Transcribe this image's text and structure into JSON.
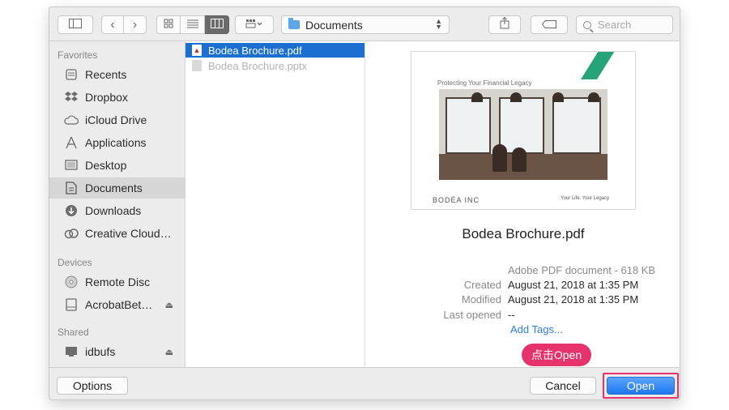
{
  "toolbar": {
    "location": "Documents",
    "search_placeholder": "Search"
  },
  "sidebar": {
    "favorites_label": "Favorites",
    "favorites": [
      {
        "label": "Recents",
        "icon": "clock-icon"
      },
      {
        "label": "Dropbox",
        "icon": "dropbox-icon"
      },
      {
        "label": "iCloud Drive",
        "icon": "cloud-icon"
      },
      {
        "label": "Applications",
        "icon": "applications-icon"
      },
      {
        "label": "Desktop",
        "icon": "desktop-icon"
      },
      {
        "label": "Documents",
        "icon": "document-icon",
        "selected": true
      },
      {
        "label": "Downloads",
        "icon": "download-icon"
      },
      {
        "label": "Creative Cloud…",
        "icon": "creative-cloud-icon"
      }
    ],
    "devices_label": "Devices",
    "devices": [
      {
        "label": "Remote Disc",
        "icon": "disc-icon"
      },
      {
        "label": "AcrobatBet…",
        "icon": "drive-icon",
        "eject": true
      }
    ],
    "shared_label": "Shared",
    "shared": [
      {
        "label": "idbufs",
        "icon": "computer-icon",
        "eject": true
      }
    ]
  },
  "files": [
    {
      "name": "Bodea Brochure.pdf",
      "selected": true
    },
    {
      "name": "Bodea Brochure.pptx",
      "selected": false
    }
  ],
  "preview": {
    "thumb_title": "Protecting Your Financial Legacy",
    "thumb_logo": "BODÉA INC",
    "thumb_tagline": "Your Life. Your Legacy",
    "filename": "Bodea Brochure.pdf",
    "kind": "Adobe PDF document - 618 KB",
    "created_label": "Created",
    "created": "August 21, 2018 at 1:35 PM",
    "modified_label": "Modified",
    "modified": "August 21, 2018 at 1:35 PM",
    "last_opened_label": "Last opened",
    "last_opened": "--",
    "add_tags": "Add Tags..."
  },
  "annotation": "点击Open",
  "buttons": {
    "options": "Options",
    "cancel": "Cancel",
    "open": "Open"
  },
  "colors": {
    "accent": "#1a6fd1",
    "highlight": "#e6336e",
    "brand_stripe": "#27a37a"
  }
}
